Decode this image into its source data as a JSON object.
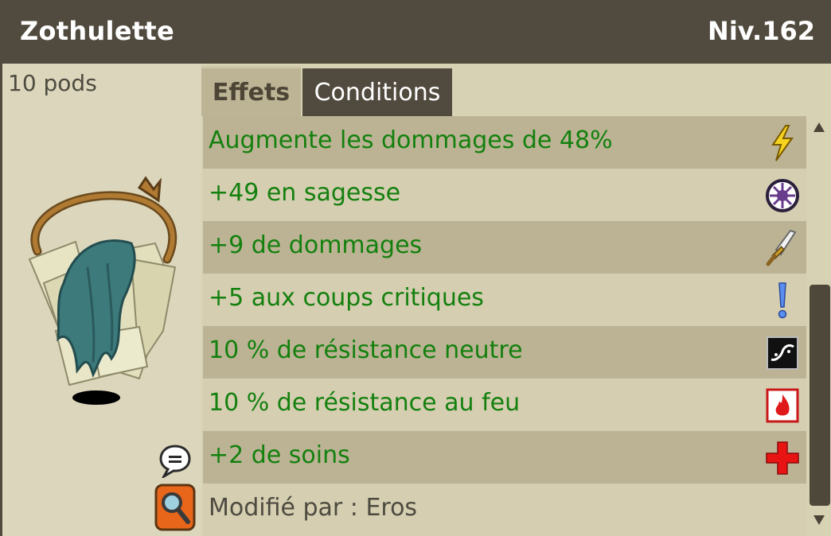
{
  "item": {
    "name": "Zothulette",
    "level": "Niv.162",
    "pods": "10 pods"
  },
  "tabs": [
    {
      "label": "Effets",
      "active": true
    },
    {
      "label": "Conditions",
      "active": false
    }
  ],
  "effects": [
    {
      "text": "Augmente les dommages de 48%",
      "icon": "lightning-icon"
    },
    {
      "text": "+49 en sagesse",
      "icon": "wisdom-icon"
    },
    {
      "text": "+9 de dommages",
      "icon": "sword-icon"
    },
    {
      "text": "+5 aux coups critiques",
      "icon": "exclamation-icon"
    },
    {
      "text": "10 % de résistance neutre",
      "icon": "neutral-resistance-icon"
    },
    {
      "text": "10 % de résistance au feu",
      "icon": "fire-resistance-icon"
    },
    {
      "text": "+2 de soins",
      "icon": "heal-cross-icon"
    }
  ],
  "modified_by": "Modifié par : Eros",
  "colors": {
    "titlebar": "#514a3e",
    "effect_text": "#14800e",
    "row_dark": "#bbb394",
    "row_light": "#d5ceb1"
  }
}
